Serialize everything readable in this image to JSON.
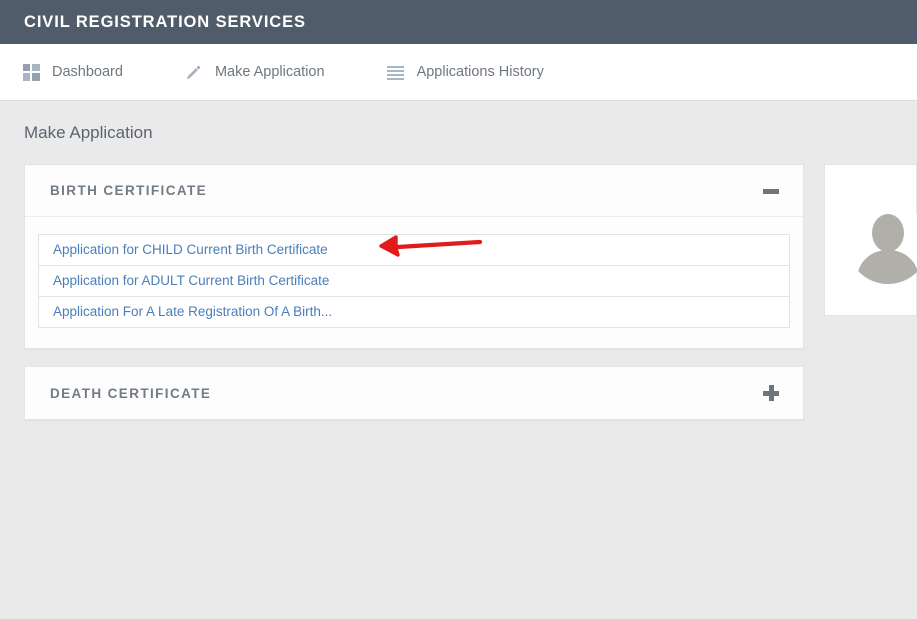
{
  "header": {
    "brand_title": "CIVIL REGISTRATION SERVICES",
    "background_color": "#515c6b",
    "text_color": "#ffffff"
  },
  "nav": {
    "items": [
      {
        "label": "Dashboard",
        "icon": "grid-dashboard-icon"
      },
      {
        "label": "Make Application",
        "icon": "pencil-icon"
      },
      {
        "label": "Applications History",
        "icon": "list-lines-icon"
      }
    ]
  },
  "main": {
    "page_title": "Make Application",
    "panels": [
      {
        "title": "BIRTH CERTIFICATE",
        "toggle_icon": "minus-icon",
        "expanded": true,
        "items": [
          "Application for CHILD Current Birth Certificate",
          "Application for ADULT Current Birth Certificate",
          "Application For A Late Registration Of A Birth..."
        ]
      },
      {
        "title": "DEATH CERTIFICATE",
        "toggle_icon": "plus-icon",
        "expanded": false,
        "items": []
      }
    ]
  },
  "sidebar": {
    "avatar": {
      "icon": "user-avatar-placeholder-icon",
      "silhouette_color": "#b0afa9"
    }
  },
  "annotation": {
    "type": "hand-drawn-arrow",
    "color": "#e01b1b",
    "direction": "left",
    "points_at": "Application for CHILD Current Birth Certificate"
  },
  "colors": {
    "link": "#4a7ebb",
    "panel_title": "#737b85",
    "page_background": "#eaeaea",
    "panel_background": "#fdfdfd"
  }
}
